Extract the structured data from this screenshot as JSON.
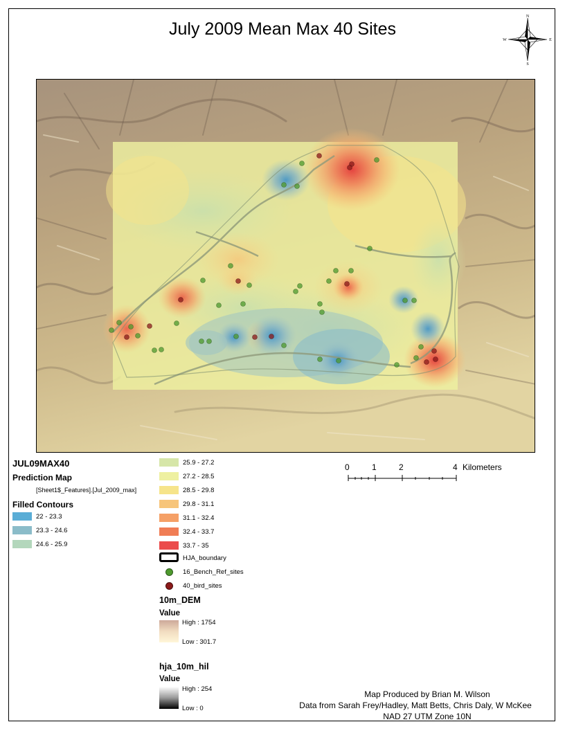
{
  "title": "July 2009 Mean Max 40 Sites",
  "north_arrow": {
    "n": "N",
    "s": "S",
    "e": "E",
    "w": "W"
  },
  "legend": {
    "layer_name": "JUL09MAX40",
    "subtitle": "Prediction Map",
    "field": "[Sheet1$_Features].[Jul_2009_max]",
    "contours_header": "Filled Contours",
    "classes": [
      {
        "label": "22 - 23.3",
        "color": "#5aadd6"
      },
      {
        "label": "23.3 - 24.6",
        "color": "#8bbcc9"
      },
      {
        "label": "24.6 - 25.9",
        "color": "#b3d7bc"
      },
      {
        "label": "25.9 - 27.2",
        "color": "#d6e6a8"
      },
      {
        "label": "27.2 - 28.5",
        "color": "#eef0a0"
      },
      {
        "label": "28.5 - 29.8",
        "color": "#f6e48a"
      },
      {
        "label": "29.8 - 31.1",
        "color": "#f7c57a"
      },
      {
        "label": "31.1 - 32.4",
        "color": "#f5a066"
      },
      {
        "label": "32.4 - 33.7",
        "color": "#f07d55"
      },
      {
        "label": "33.7 - 35",
        "color": "#eb4b4b"
      }
    ],
    "boundary_label": "HJA_boundary",
    "bench_label": "16_Bench_Ref_sites",
    "bird_label": "40_bird_sites",
    "dem": {
      "name": "10m_DEM",
      "value": "Value",
      "high": "High : 1754",
      "low": "Low : 301.7"
    },
    "hill": {
      "name": "hja_10m_hil",
      "value": "Value",
      "high": "High : 254",
      "low": "Low : 0"
    }
  },
  "scale": {
    "ticks": [
      "0",
      "1",
      "2",
      "4"
    ],
    "units": "Kilometers"
  },
  "credits": {
    "line1": "Map Produced by Brian M. Wilson",
    "line2": "Data from Sarah Frey/Hadley, Matt Betts, Chris Daly, W McKee",
    "line3": "NAD 27 UTM Zone 10N"
  },
  "colors": {
    "bench_site": "#4e9a2e",
    "bird_site": "#8b1a1a"
  }
}
